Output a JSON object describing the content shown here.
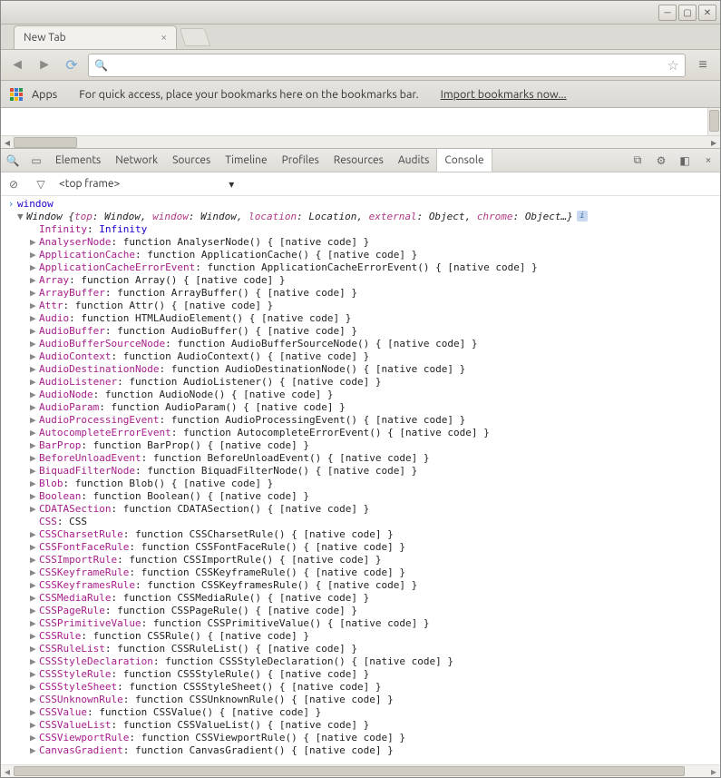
{
  "window": {
    "tab_title": "New Tab"
  },
  "bookmarkbar": {
    "apps_label": "Apps",
    "hint": "For quick access, place your bookmarks here on the bookmarks bar.",
    "import_link": "Import bookmarks now..."
  },
  "devtools": {
    "tabs": [
      "Elements",
      "Network",
      "Sources",
      "Timeline",
      "Profiles",
      "Resources",
      "Audits",
      "Console"
    ],
    "active_tab": "Console",
    "frame_selector": "<top frame>",
    "input_expr": "window",
    "result_header": {
      "prefix": "Window {",
      "pairs": [
        {
          "k": "top",
          "v": "Window"
        },
        {
          "k": "window",
          "v": "Window"
        },
        {
          "k": "location",
          "v": "Location"
        },
        {
          "k": "external",
          "v": "Object"
        },
        {
          "k": "chrome",
          "v": "Object…"
        }
      ],
      "suffix": "}"
    },
    "first_prop": {
      "name": "Infinity",
      "value": "Infinity"
    },
    "properties": [
      {
        "name": "AnalyserNode",
        "value": "function AnalyserNode() { [native code] }"
      },
      {
        "name": "ApplicationCache",
        "value": "function ApplicationCache() { [native code] }"
      },
      {
        "name": "ApplicationCacheErrorEvent",
        "value": "function ApplicationCacheErrorEvent() { [native code] }"
      },
      {
        "name": "Array",
        "value": "function Array() { [native code] }"
      },
      {
        "name": "ArrayBuffer",
        "value": "function ArrayBuffer() { [native code] }"
      },
      {
        "name": "Attr",
        "value": "function Attr() { [native code] }"
      },
      {
        "name": "Audio",
        "value": "function HTMLAudioElement() { [native code] }"
      },
      {
        "name": "AudioBuffer",
        "value": "function AudioBuffer() { [native code] }"
      },
      {
        "name": "AudioBufferSourceNode",
        "value": "function AudioBufferSourceNode() { [native code] }"
      },
      {
        "name": "AudioContext",
        "value": "function AudioContext() { [native code] }"
      },
      {
        "name": "AudioDestinationNode",
        "value": "function AudioDestinationNode() { [native code] }"
      },
      {
        "name": "AudioListener",
        "value": "function AudioListener() { [native code] }"
      },
      {
        "name": "AudioNode",
        "value": "function AudioNode() { [native code] }"
      },
      {
        "name": "AudioParam",
        "value": "function AudioParam() { [native code] }"
      },
      {
        "name": "AudioProcessingEvent",
        "value": "function AudioProcessingEvent() { [native code] }"
      },
      {
        "name": "AutocompleteErrorEvent",
        "value": "function AutocompleteErrorEvent() { [native code] }"
      },
      {
        "name": "BarProp",
        "value": "function BarProp() { [native code] }"
      },
      {
        "name": "BeforeUnloadEvent",
        "value": "function BeforeUnloadEvent() { [native code] }"
      },
      {
        "name": "BiquadFilterNode",
        "value": "function BiquadFilterNode() { [native code] }"
      },
      {
        "name": "Blob",
        "value": "function Blob() { [native code] }"
      },
      {
        "name": "Boolean",
        "value": "function Boolean() { [native code] }"
      },
      {
        "name": "CDATASection",
        "value": "function CDATASection() { [native code] }"
      },
      {
        "name": "CSS",
        "value": "CSS",
        "noexpand": true
      },
      {
        "name": "CSSCharsetRule",
        "value": "function CSSCharsetRule() { [native code] }"
      },
      {
        "name": "CSSFontFaceRule",
        "value": "function CSSFontFaceRule() { [native code] }"
      },
      {
        "name": "CSSImportRule",
        "value": "function CSSImportRule() { [native code] }"
      },
      {
        "name": "CSSKeyframeRule",
        "value": "function CSSKeyframeRule() { [native code] }"
      },
      {
        "name": "CSSKeyframesRule",
        "value": "function CSSKeyframesRule() { [native code] }"
      },
      {
        "name": "CSSMediaRule",
        "value": "function CSSMediaRule() { [native code] }"
      },
      {
        "name": "CSSPageRule",
        "value": "function CSSPageRule() { [native code] }"
      },
      {
        "name": "CSSPrimitiveValue",
        "value": "function CSSPrimitiveValue() { [native code] }"
      },
      {
        "name": "CSSRule",
        "value": "function CSSRule() { [native code] }"
      },
      {
        "name": "CSSRuleList",
        "value": "function CSSRuleList() { [native code] }"
      },
      {
        "name": "CSSStyleDeclaration",
        "value": "function CSSStyleDeclaration() { [native code] }"
      },
      {
        "name": "CSSStyleRule",
        "value": "function CSSStyleRule() { [native code] }"
      },
      {
        "name": "CSSStyleSheet",
        "value": "function CSSStyleSheet() { [native code] }"
      },
      {
        "name": "CSSUnknownRule",
        "value": "function CSSUnknownRule() { [native code] }"
      },
      {
        "name": "CSSValue",
        "value": "function CSSValue() { [native code] }"
      },
      {
        "name": "CSSValueList",
        "value": "function CSSValueList() { [native code] }"
      },
      {
        "name": "CSSViewportRule",
        "value": "function CSSViewportRule() { [native code] }"
      },
      {
        "name": "CanvasGradient",
        "value": "function CanvasGradient() { [native code] }"
      }
    ]
  }
}
